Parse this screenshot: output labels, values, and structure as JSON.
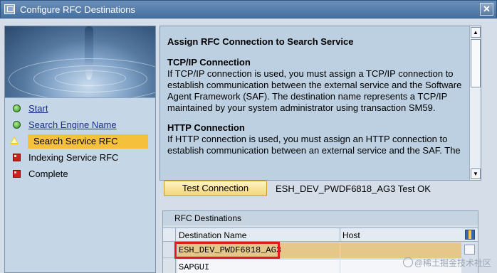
{
  "window": {
    "title": "Configure RFC Destinations",
    "close_glyph": "✕"
  },
  "nav": {
    "items": [
      {
        "label": "Start",
        "status": "done"
      },
      {
        "label": "Search Engine Name",
        "status": "done"
      },
      {
        "label": "Search Service RFC",
        "status": "current"
      },
      {
        "label": "Indexing Service RFC",
        "status": "pending"
      },
      {
        "label": "Complete",
        "status": "pending"
      }
    ]
  },
  "info": {
    "heading": "Assign RFC Connection to Search Service",
    "tcp_title": "TCP/IP Connection",
    "tcp_text": "If TCP/IP connection is used, you must assign a TCP/IP connection to establish communication between the external service and the Software Agent Framework (SAF). The destination name represents a TCP/IP maintained by your system administrator using transaction SM59.",
    "http_title": "HTTP Connection",
    "http_text": "If HTTP connection is used, you must assign an HTTP connection to establish communication between an external service and the SAF. The"
  },
  "test": {
    "button_label": "Test Connection",
    "status": "ESH_DEV_PWDF6818_AG3 Test OK"
  },
  "table": {
    "caption": "RFC Destinations",
    "columns": [
      "Destination Name",
      "Host"
    ],
    "rows": [
      {
        "name": "ESH_DEV_PWDF6818_AG3",
        "host": "",
        "selected": true
      },
      {
        "name": "SAPGUI",
        "host": "",
        "selected": false
      }
    ]
  },
  "watermark": "@稀土掘金技术社区",
  "colors": {
    "title_bar": "#47709f",
    "active_step": "#f5c03b",
    "selected_row": "#e6c78a",
    "highlight_box": "#e11b1b"
  }
}
